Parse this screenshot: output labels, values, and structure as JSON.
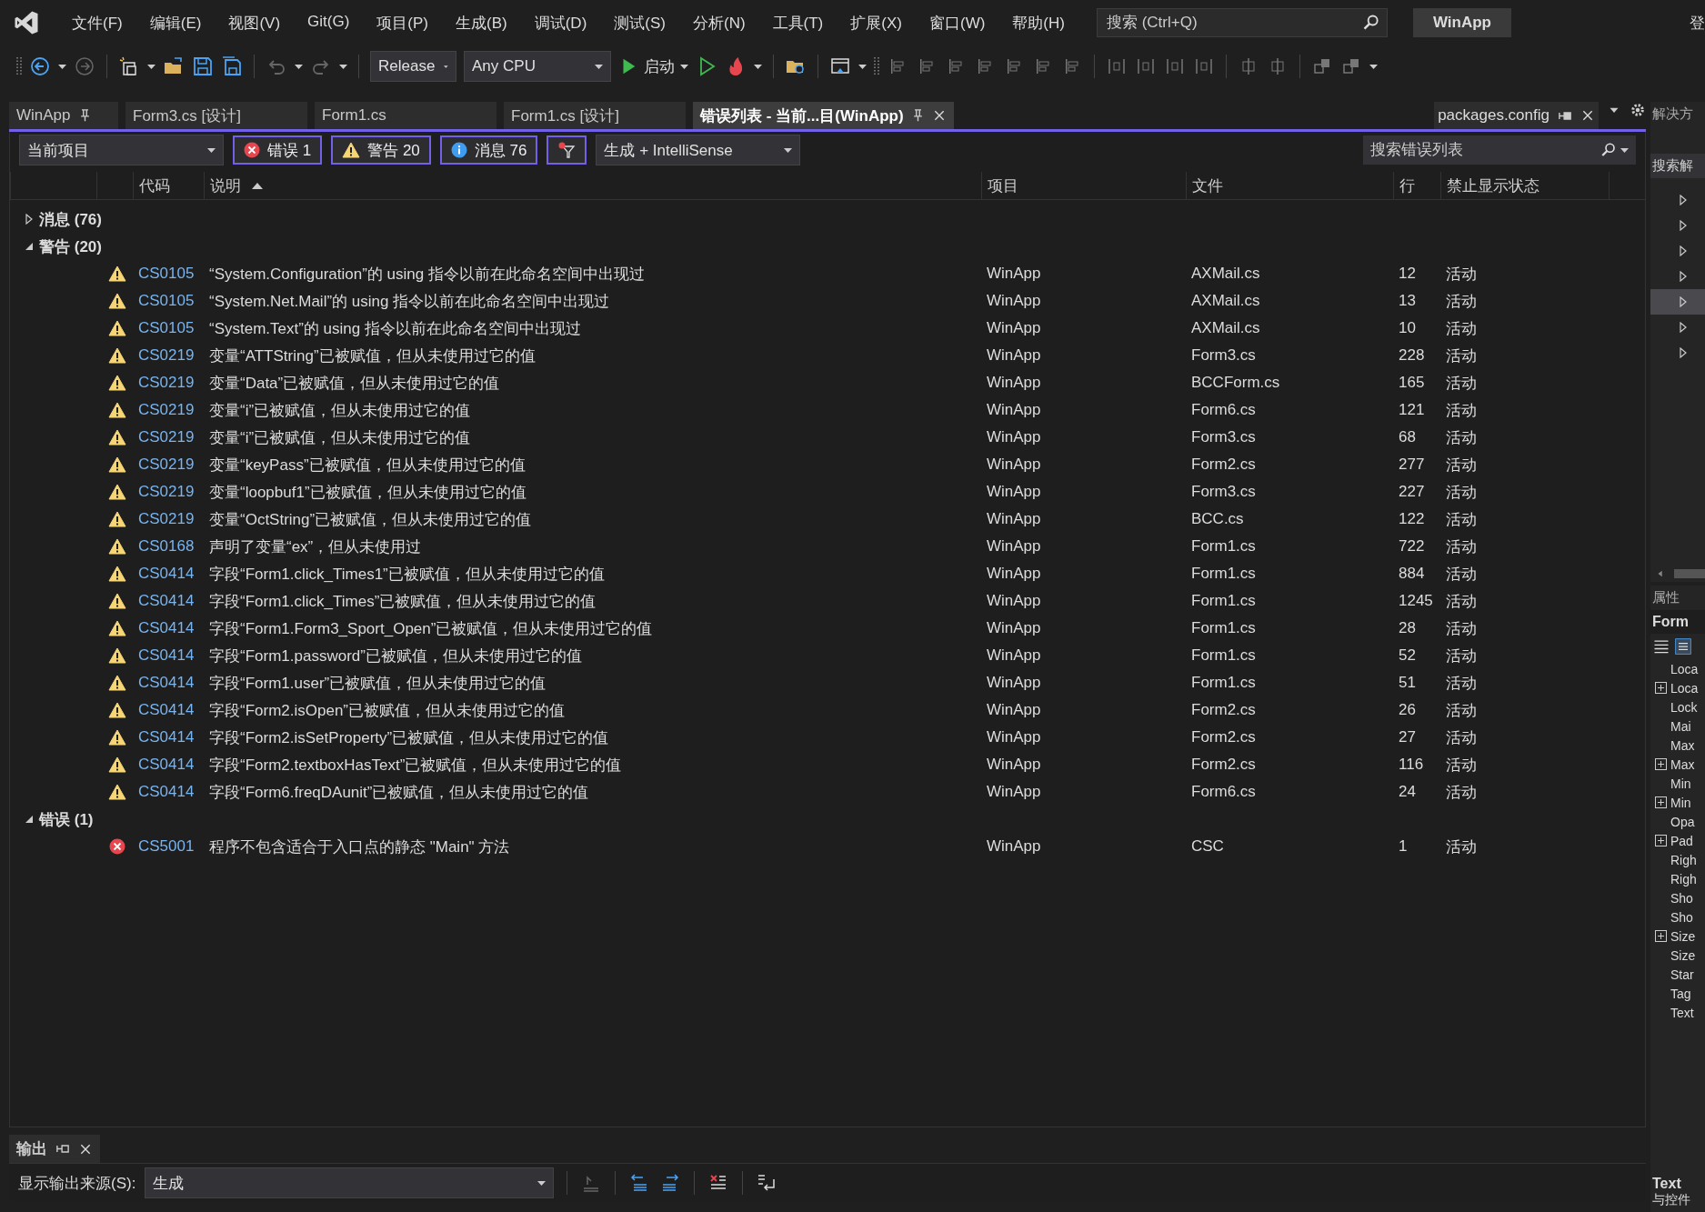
{
  "menu": [
    "文件(F)",
    "编辑(E)",
    "视图(V)",
    "Git(G)",
    "项目(P)",
    "生成(B)",
    "调试(D)",
    "测试(S)",
    "分析(N)",
    "工具(T)",
    "扩展(X)",
    "窗口(W)",
    "帮助(H)"
  ],
  "search": {
    "placeholder": "搜索 (Ctrl+Q)"
  },
  "solution_name": "WinApp",
  "account": "登",
  "toolbar": {
    "configuration": "Release",
    "platform": "Any CPU",
    "start": "启动"
  },
  "document_tabs": [
    {
      "label": "WinApp",
      "selected": false,
      "pinned": true
    },
    {
      "label": "Form3.cs [设计]",
      "selected": false,
      "pinned": false
    },
    {
      "label": "Form1.cs",
      "selected": false,
      "pinned": false
    },
    {
      "label": "Form1.cs [设计]",
      "selected": false,
      "pinned": false
    },
    {
      "label": "错误列表 - 当前...目(WinApp)",
      "selected": true,
      "pinned": false
    }
  ],
  "right_tab": {
    "label": "packages.config"
  },
  "error_list": {
    "scope": "当前项目",
    "filters": [
      {
        "kind": "error",
        "label": "错误 1",
        "selected": true
      },
      {
        "kind": "warning",
        "label": "警告 20",
        "selected": true
      },
      {
        "kind": "info",
        "label": "消息 76",
        "selected": true
      },
      {
        "kind": "filter",
        "selected": true
      }
    ],
    "source": "生成 + IntelliSense",
    "search_placeholder": "搜索错误列表",
    "columns": [
      {
        "label": "代码",
        "sorted": false
      },
      {
        "label": "说明",
        "sorted": true
      },
      {
        "label": "项目",
        "sorted": false
      },
      {
        "label": "文件",
        "sorted": false
      },
      {
        "label": "行",
        "sorted": false
      },
      {
        "label": "禁止显示状态",
        "sorted": false
      }
    ],
    "groups": [
      {
        "label": "消息 (76)",
        "expanded": false
      },
      {
        "label": "警告 (20)",
        "expanded": true,
        "rows": [
          {
            "kind": "warning",
            "code": "CS0105",
            "description": "“System.Configuration”的 using 指令以前在此命名空间中出现过",
            "project": "WinApp",
            "file": "AXMail.cs",
            "line": "12",
            "suppression": "活动"
          },
          {
            "kind": "warning",
            "code": "CS0105",
            "description": "“System.Net.Mail”的 using 指令以前在此命名空间中出现过",
            "project": "WinApp",
            "file": "AXMail.cs",
            "line": "13",
            "suppression": "活动"
          },
          {
            "kind": "warning",
            "code": "CS0105",
            "description": "“System.Text”的 using 指令以前在此命名空间中出现过",
            "project": "WinApp",
            "file": "AXMail.cs",
            "line": "10",
            "suppression": "活动"
          },
          {
            "kind": "warning",
            "code": "CS0219",
            "description": "变量“ATTString”已被赋值，但从未使用过它的值",
            "project": "WinApp",
            "file": "Form3.cs",
            "line": "228",
            "suppression": "活动"
          },
          {
            "kind": "warning",
            "code": "CS0219",
            "description": "变量“Data”已被赋值，但从未使用过它的值",
            "project": "WinApp",
            "file": "BCCForm.cs",
            "line": "165",
            "suppression": "活动"
          },
          {
            "kind": "warning",
            "code": "CS0219",
            "description": "变量“i”已被赋值，但从未使用过它的值",
            "project": "WinApp",
            "file": "Form6.cs",
            "line": "121",
            "suppression": "活动"
          },
          {
            "kind": "warning",
            "code": "CS0219",
            "description": "变量“i”已被赋值，但从未使用过它的值",
            "project": "WinApp",
            "file": "Form3.cs",
            "line": "68",
            "suppression": "活动"
          },
          {
            "kind": "warning",
            "code": "CS0219",
            "description": "变量“keyPass”已被赋值，但从未使用过它的值",
            "project": "WinApp",
            "file": "Form2.cs",
            "line": "277",
            "suppression": "活动"
          },
          {
            "kind": "warning",
            "code": "CS0219",
            "description": "变量“loopbuf1”已被赋值，但从未使用过它的值",
            "project": "WinApp",
            "file": "Form3.cs",
            "line": "227",
            "suppression": "活动"
          },
          {
            "kind": "warning",
            "code": "CS0219",
            "description": "变量“OctString”已被赋值，但从未使用过它的值",
            "project": "WinApp",
            "file": "BCC.cs",
            "line": "122",
            "suppression": "活动"
          },
          {
            "kind": "warning",
            "code": "CS0168",
            "description": "声明了变量“ex”，但从未使用过",
            "project": "WinApp",
            "file": "Form1.cs",
            "line": "722",
            "suppression": "活动"
          },
          {
            "kind": "warning",
            "code": "CS0414",
            "description": "字段“Form1.click_Times1”已被赋值，但从未使用过它的值",
            "project": "WinApp",
            "file": "Form1.cs",
            "line": "884",
            "suppression": "活动"
          },
          {
            "kind": "warning",
            "code": "CS0414",
            "description": "字段“Form1.click_Times”已被赋值，但从未使用过它的值",
            "project": "WinApp",
            "file": "Form1.cs",
            "line": "1245",
            "suppression": "活动"
          },
          {
            "kind": "warning",
            "code": "CS0414",
            "description": "字段“Form1.Form3_Sport_Open”已被赋值，但从未使用过它的值",
            "project": "WinApp",
            "file": "Form1.cs",
            "line": "28",
            "suppression": "活动"
          },
          {
            "kind": "warning",
            "code": "CS0414",
            "description": "字段“Form1.password”已被赋值，但从未使用过它的值",
            "project": "WinApp",
            "file": "Form1.cs",
            "line": "52",
            "suppression": "活动"
          },
          {
            "kind": "warning",
            "code": "CS0414",
            "description": "字段“Form1.user”已被赋值，但从未使用过它的值",
            "project": "WinApp",
            "file": "Form1.cs",
            "line": "51",
            "suppression": "活动"
          },
          {
            "kind": "warning",
            "code": "CS0414",
            "description": "字段“Form2.isOpen”已被赋值，但从未使用过它的值",
            "project": "WinApp",
            "file": "Form2.cs",
            "line": "26",
            "suppression": "活动"
          },
          {
            "kind": "warning",
            "code": "CS0414",
            "description": "字段“Form2.isSetProperty”已被赋值，但从未使用过它的值",
            "project": "WinApp",
            "file": "Form2.cs",
            "line": "27",
            "suppression": "活动"
          },
          {
            "kind": "warning",
            "code": "CS0414",
            "description": "字段“Form2.textboxHasText”已被赋值，但从未使用过它的值",
            "project": "WinApp",
            "file": "Form2.cs",
            "line": "116",
            "suppression": "活动"
          },
          {
            "kind": "warning",
            "code": "CS0414",
            "description": "字段“Form6.freqDAunit”已被赋值，但从未使用过它的值",
            "project": "WinApp",
            "file": "Form6.cs",
            "line": "24",
            "suppression": "活动"
          }
        ]
      },
      {
        "label": "错误 (1)",
        "expanded": true,
        "rows": [
          {
            "kind": "error",
            "code": "CS5001",
            "description": "程序不包含适合于入口点的静态 \"Main\" 方法",
            "project": "WinApp",
            "file": "CSC",
            "line": "1",
            "suppression": "活动"
          }
        ]
      }
    ]
  },
  "output": {
    "tab": "输出",
    "source_label": "显示输出来源(S):",
    "source": "生成"
  },
  "solution_explorer": {
    "title": "解决方",
    "search_placeholder": "搜索解",
    "items": [
      {
        "selected": false
      },
      {
        "selected": false
      },
      {
        "selected": false
      },
      {
        "selected": false
      },
      {
        "selected": true
      },
      {
        "selected": false
      },
      {
        "selected": false
      }
    ]
  },
  "properties": {
    "title": "属性",
    "object": "Form",
    "rows": [
      {
        "name": "Loca",
        "expandable": false
      },
      {
        "name": "Loca",
        "expandable": true
      },
      {
        "name": "Lock",
        "expandable": false
      },
      {
        "name": "Mai",
        "expandable": false
      },
      {
        "name": "Max",
        "expandable": false
      },
      {
        "name": "Max",
        "expandable": true
      },
      {
        "name": "Min",
        "expandable": false
      },
      {
        "name": "Min",
        "expandable": true
      },
      {
        "name": "Opa",
        "expandable": false
      },
      {
        "name": "Pad",
        "expandable": true
      },
      {
        "name": "Righ",
        "expandable": false
      },
      {
        "name": "Righ",
        "expandable": false
      },
      {
        "name": "Sho",
        "expandable": false
      },
      {
        "name": "Sho",
        "expandable": false
      },
      {
        "name": "Size",
        "expandable": true
      },
      {
        "name": "Size",
        "expandable": false
      },
      {
        "name": "Star",
        "expandable": false
      },
      {
        "name": "Tag",
        "expandable": false
      },
      {
        "name": "Text",
        "expandable": false
      }
    ],
    "description_title": "Text",
    "description": "与控件"
  }
}
